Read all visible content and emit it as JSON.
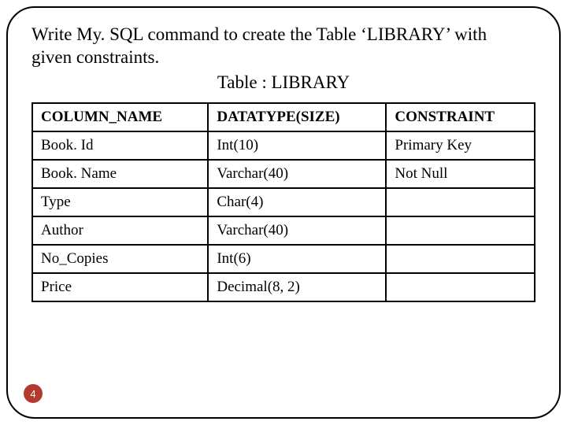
{
  "prompt_line1": "Write My. SQL command to create the Table ‘LIBRARY’ with",
  "prompt_line2": "given constraints.",
  "table_title": "Table : LIBRARY",
  "headers": {
    "col1": "COLUMN_NAME",
    "col2": "DATATYPE(SIZE)",
    "col3": "CONSTRAINT"
  },
  "rows": [
    {
      "c1": "Book. Id",
      "c2": "Int(10)",
      "c3": "Primary Key"
    },
    {
      "c1": "Book. Name",
      "c2": "Varchar(40)",
      "c3": "Not Null"
    },
    {
      "c1": "Type",
      "c2": "Char(4)",
      "c3": ""
    },
    {
      "c1": "Author",
      "c2": "Varchar(40)",
      "c3": ""
    },
    {
      "c1": "No_Copies",
      "c2": "Int(6)",
      "c3": ""
    },
    {
      "c1": "Price",
      "c2": "Decimal(8, 2)",
      "c3": ""
    }
  ],
  "page_number": "4"
}
